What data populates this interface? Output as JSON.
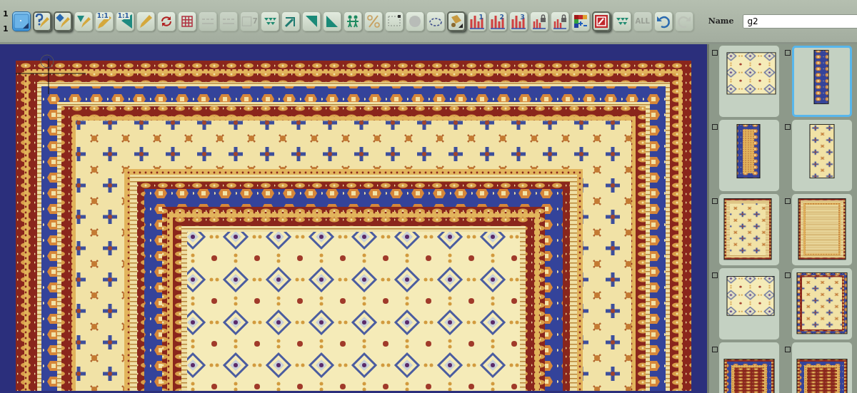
{
  "row_markers": [
    "1",
    "1"
  ],
  "toolbar": {
    "buttons": [
      {
        "kind": "tile",
        "selected": true,
        "pressed": false,
        "disabled": false
      },
      {
        "kind": "help-pencil",
        "selected": false,
        "pressed": true,
        "disabled": false
      },
      {
        "kind": "diamond-pencil",
        "selected": false,
        "pressed": true,
        "disabled": false
      },
      {
        "kind": "triangle-pencil",
        "selected": false,
        "pressed": false,
        "disabled": false
      },
      {
        "kind": "scale-pencil",
        "label": "1:1",
        "selected": false,
        "pressed": false,
        "disabled": false
      },
      {
        "kind": "scale-triangle",
        "label": "1:1",
        "selected": false,
        "pressed": false,
        "disabled": false
      },
      {
        "kind": "pencil",
        "selected": false,
        "pressed": false,
        "disabled": false
      },
      {
        "kind": "refresh",
        "selected": false,
        "pressed": false,
        "disabled": false
      },
      {
        "kind": "grid",
        "selected": false,
        "pressed": false,
        "disabled": false
      },
      {
        "kind": "digits",
        "selected": false,
        "pressed": false,
        "disabled": true
      },
      {
        "kind": "digits",
        "selected": false,
        "pressed": false,
        "disabled": true
      },
      {
        "kind": "number",
        "label": "7",
        "selected": false,
        "pressed": false,
        "disabled": true
      },
      {
        "kind": "arrows",
        "selected": false,
        "pressed": false,
        "disabled": false
      },
      {
        "kind": "diagonal",
        "selected": false,
        "pressed": false,
        "disabled": false
      },
      {
        "kind": "triangle-right",
        "selected": false,
        "pressed": false,
        "disabled": false
      },
      {
        "kind": "triangle-left",
        "selected": false,
        "pressed": false,
        "disabled": false
      },
      {
        "kind": "people",
        "selected": false,
        "pressed": false,
        "disabled": false
      },
      {
        "kind": "percent",
        "selected": false,
        "pressed": false,
        "disabled": false
      },
      {
        "kind": "frame",
        "selected": false,
        "pressed": false,
        "disabled": false
      },
      {
        "kind": "circle",
        "selected": false,
        "pressed": false,
        "disabled": false
      },
      {
        "kind": "loop",
        "selected": false,
        "pressed": false,
        "disabled": false
      },
      {
        "kind": "bucket",
        "selected": false,
        "pressed": true,
        "disabled": false
      },
      {
        "kind": "bars",
        "label": "1",
        "selected": false,
        "pressed": false,
        "disabled": false
      },
      {
        "kind": "bars",
        "label": "2",
        "selected": false,
        "pressed": false,
        "disabled": false
      },
      {
        "kind": "bars",
        "label": "3",
        "selected": false,
        "pressed": false,
        "disabled": false
      },
      {
        "kind": "bars-lock",
        "selected": false,
        "pressed": false,
        "disabled": false
      },
      {
        "kind": "bars-lock",
        "selected": false,
        "pressed": false,
        "disabled": false
      },
      {
        "kind": "palette",
        "selected": false,
        "pressed": false,
        "disabled": false
      },
      {
        "kind": "edit",
        "selected": false,
        "pressed": true,
        "disabled": false
      },
      {
        "kind": "arrows",
        "selected": false,
        "pressed": false,
        "disabled": false
      },
      {
        "kind": "all",
        "label": "ALL",
        "selected": false,
        "pressed": false,
        "disabled": true
      },
      {
        "kind": "undo",
        "selected": false,
        "pressed": false,
        "disabled": false
      },
      {
        "kind": "redo",
        "selected": false,
        "pressed": false,
        "disabled": true
      }
    ],
    "name_field": {
      "label": "Name",
      "value": "g2"
    }
  },
  "thumbnails": [
    {
      "kind": "field",
      "selected": false,
      "checked": false
    },
    {
      "kind": "strip-arch",
      "selected": true,
      "checked": false
    },
    {
      "kind": "strip-medallion",
      "selected": false,
      "checked": false
    },
    {
      "kind": "strip-cross",
      "selected": false,
      "checked": false
    },
    {
      "kind": "corner",
      "selected": false,
      "checked": false
    },
    {
      "kind": "bordered",
      "selected": false,
      "checked": false
    },
    {
      "kind": "tile",
      "selected": false,
      "checked": false
    },
    {
      "kind": "corner-ornate",
      "selected": false,
      "checked": false
    },
    {
      "kind": "border-band",
      "selected": false,
      "checked": false
    },
    {
      "kind": "border-band",
      "selected": false,
      "checked": false
    }
  ]
}
